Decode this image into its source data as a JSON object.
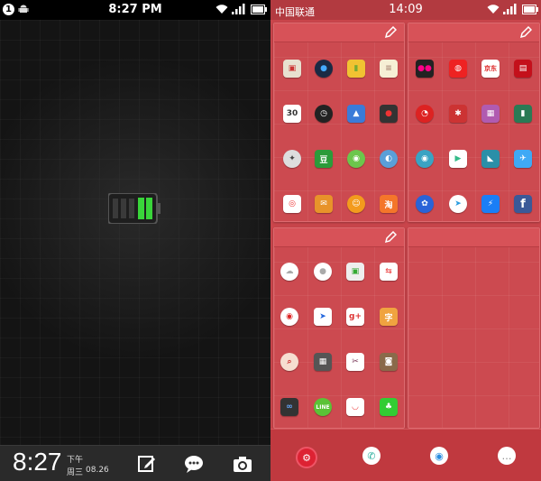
{
  "left_screen": {
    "status_bar": {
      "notification_count": "1",
      "time": "8:27 PM"
    },
    "lock_bar": {
      "time": "8:27",
      "ampm": "下午",
      "weekday": "周三",
      "date": "08.26"
    },
    "battery_level": 0.4
  },
  "right_screen": {
    "status_bar": {
      "carrier": "中国联通",
      "time": "14:09"
    },
    "folders": [
      {
        "name": "folder-top-left",
        "apps": [
          "app-store",
          "camera",
          "chart",
          "notes",
          "calendar",
          "clock",
          "gallery",
          "record",
          "car",
          "douban",
          "wechat",
          "browser",
          "weibo",
          "mail",
          "contacts",
          "taobao"
        ]
      },
      {
        "name": "folder-top-right",
        "apps": [
          "flickr",
          "mi-game",
          "jd",
          "tmall",
          "netease",
          "ladybug",
          "gamepad",
          "evernote-green",
          "maps",
          "play-store",
          "tv",
          "twitter",
          "baidu",
          "telegram",
          "messenger",
          "facebook"
        ]
      },
      {
        "name": "folder-bottom-left",
        "apps": [
          "cloud",
          "voice",
          "screenshot",
          "cloud-sync",
          "music",
          "mail-send",
          "google-plus",
          "fonts",
          "search",
          "calculator",
          "theme",
          "instagram",
          "remote",
          "line",
          "pocket",
          "evernote"
        ]
      }
    ],
    "app_labels": {
      "calendar": "30",
      "douban": "豆",
      "jd": "京东",
      "google_plus": "g+",
      "line": "LINE",
      "taobao": "淘",
      "facebook": "f"
    }
  },
  "colors": {
    "accent_red": "#c9454b",
    "battery_green": "#39d53a"
  }
}
